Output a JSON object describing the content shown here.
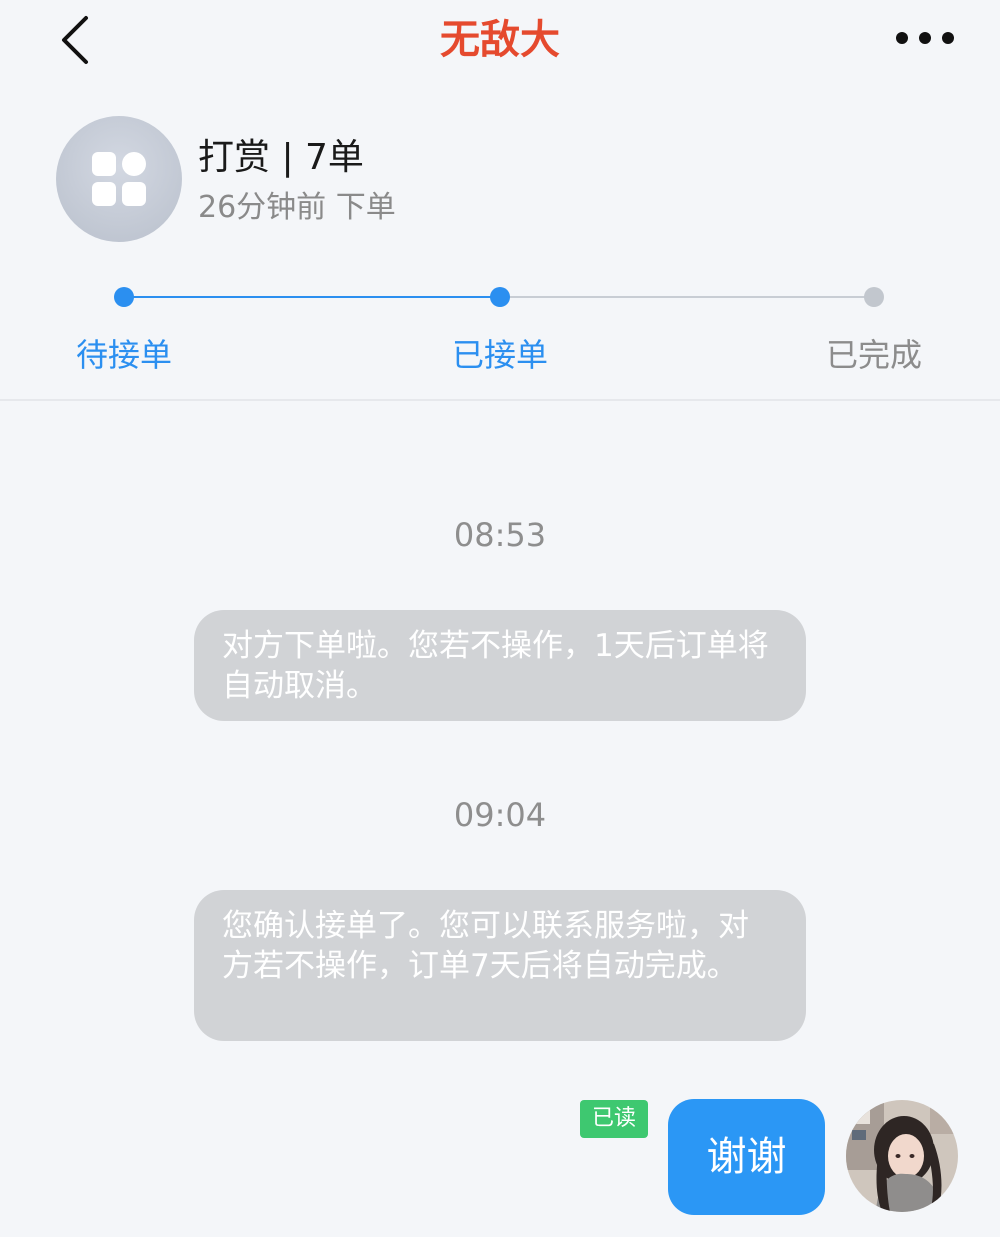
{
  "nav": {
    "title": "无敌大",
    "back_icon": "chevron-left-icon",
    "more_icon": "more-horizontal-icon"
  },
  "order": {
    "title": "打赏 | 7单",
    "subtitle": "26分钟前 下单",
    "icon": "grid-apps-icon"
  },
  "progress": {
    "steps": [
      {
        "label": "待接单",
        "state": "done"
      },
      {
        "label": "已接单",
        "state": "current"
      },
      {
        "label": "已完成",
        "state": "pending"
      }
    ],
    "active_color": "#2b8ff0",
    "inactive_color": "#8c8c8c"
  },
  "messages": [
    {
      "time": "08:53",
      "text": "对方下单啦。您若不操作，1天后订单将自动取消。"
    },
    {
      "time": "09:04",
      "text": "您确认接单了。您可以联系服务啦，对方若不操作，订单7天后将自动完成。"
    }
  ],
  "outgoing": {
    "text": "谢谢",
    "read_status": "已读"
  },
  "colors": {
    "title": "#e54a2e",
    "accent": "#2b97f5",
    "read_badge": "#3ec870",
    "system_bubble": "#d1d3d6"
  }
}
